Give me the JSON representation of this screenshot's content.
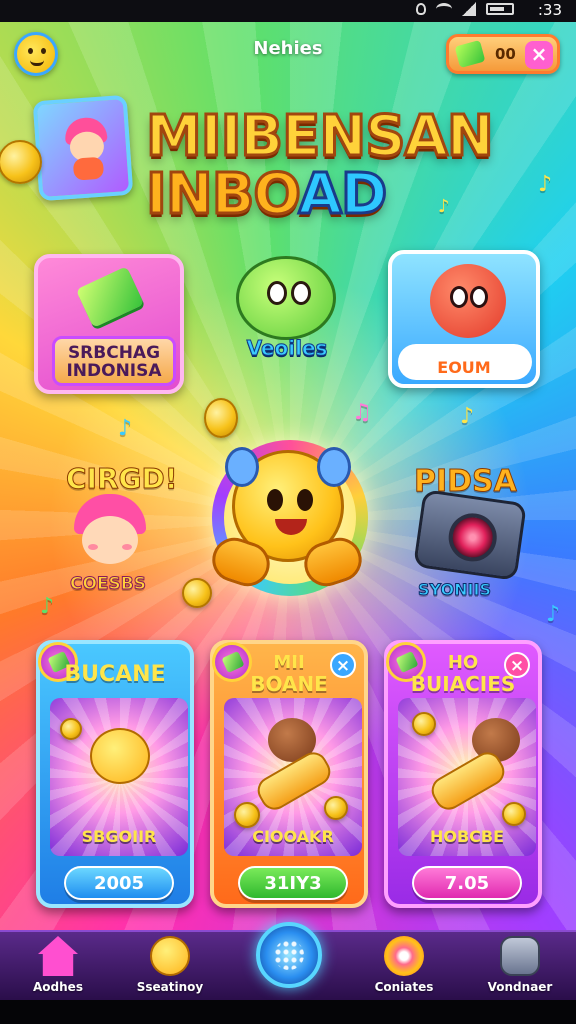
{
  "status_bar": {
    "time": ":33"
  },
  "header": {
    "title": "Nehies",
    "currency_amount": "00",
    "close_symbol": "×"
  },
  "title": {
    "line1": "MIIBENSAN",
    "line2_a": "INBO",
    "line2_b": "AD"
  },
  "features": {
    "left_tile_line1": "SRBCHAG",
    "left_tile_line2": "INDONISA",
    "right_tile_label": "EOUM",
    "middle_label": "Veoiles",
    "left_top_label": "CIRGD!",
    "left_bottom_label": "COESBS",
    "right_top_label": "PIDSA",
    "right_bottom_label": "SYONIIS"
  },
  "cards": [
    {
      "title_line1": "BUCANE",
      "title_line2": "",
      "art_label": "SBGOIIR",
      "price": "2005",
      "close_symbol": ""
    },
    {
      "title_line1": "MII",
      "title_line2": "BOANE",
      "art_label": "CIOOAKR",
      "price": "31IY3",
      "close_symbol": "×"
    },
    {
      "title_line1": "HO",
      "title_line2": "BUIACIES",
      "art_label": "HOBCBE",
      "price": "7.05",
      "close_symbol": "×"
    }
  ],
  "bottom_nav": {
    "items": [
      {
        "label": "Aodhes",
        "icon": "home-icon"
      },
      {
        "label": "Sseatinoy",
        "icon": "smiley-icon"
      },
      {
        "label": "",
        "icon": "play-button-icon"
      },
      {
        "label": "Coniates",
        "icon": "candy-icon"
      },
      {
        "label": "Vondnaer",
        "icon": "robot-icon"
      }
    ]
  },
  "colors": {
    "title_gold": "#ffd23a",
    "accent_blue": "#3acaff",
    "nav_purple": "#5a2a8a"
  }
}
